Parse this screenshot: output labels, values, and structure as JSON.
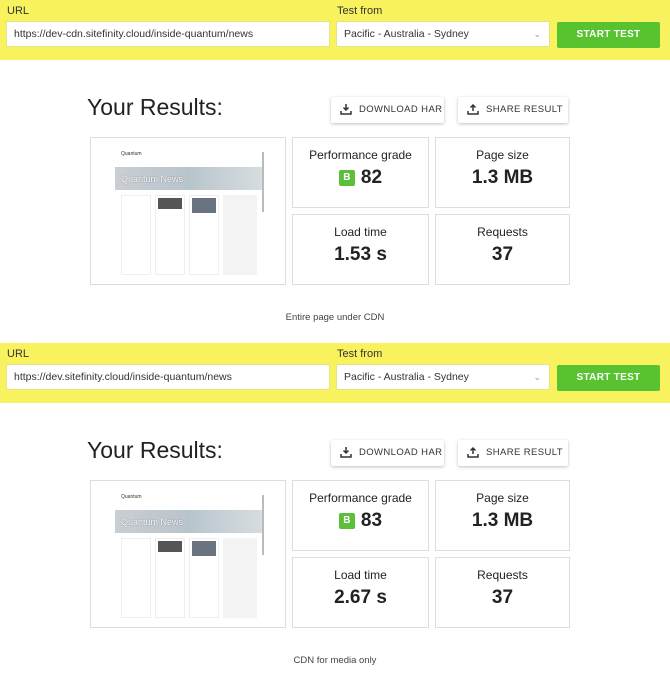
{
  "colors": {
    "band": "#f7f25d",
    "start": "#58c22f",
    "grade": "#5cbf3a"
  },
  "tests": [
    {
      "url_label": "URL",
      "url": "https://dev-cdn.sitefinity.cloud/inside-quantum/news",
      "from_label": "Test from",
      "from": "Pacific - Australia - Sydney",
      "start": "START TEST",
      "results_title": "Your Results:",
      "download": "DOWNLOAD HAR",
      "share": "SHARE RESULT",
      "thumb_title": "Quantum News",
      "thumb_brand": "Quantum",
      "perf_label": "Performance grade",
      "grade": "B",
      "perf": "82",
      "size_label": "Page size",
      "size": "1.3 MB",
      "load_label": "Load time",
      "load": "1.53 s",
      "req_label": "Requests",
      "req": "37",
      "caption": "Entire page under CDN"
    },
    {
      "url_label": "URL",
      "url": "https://dev.sitefinity.cloud/inside-quantum/news",
      "from_label": "Test from",
      "from": "Pacific - Australia - Sydney",
      "start": "START TEST",
      "results_title": "Your Results:",
      "download": "DOWNLOAD HAR",
      "share": "SHARE RESULT",
      "thumb_title": "Quantum News",
      "thumb_brand": "Quantum",
      "perf_label": "Performance grade",
      "grade": "B",
      "perf": "83",
      "size_label": "Page size",
      "size": "1.3 MB",
      "load_label": "Load time",
      "load": "2.67 s",
      "req_label": "Requests",
      "req": "37",
      "caption": "CDN for media only"
    }
  ]
}
